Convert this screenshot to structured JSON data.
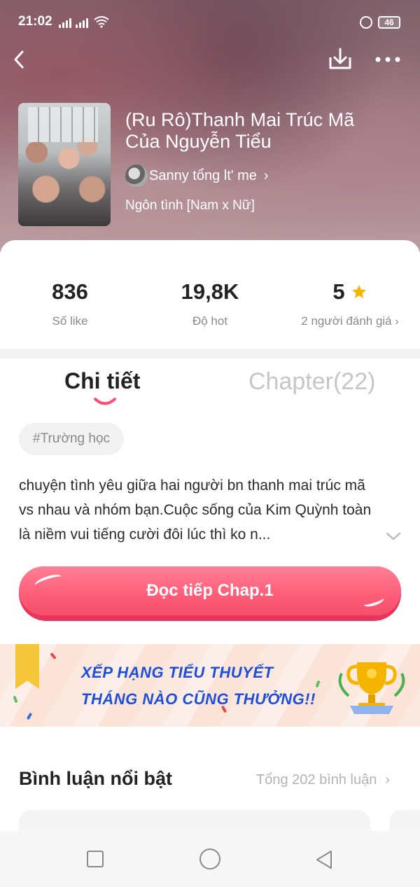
{
  "status_bar": {
    "time": "21:02",
    "battery": "46"
  },
  "book": {
    "title": "(Ru Rô)Thanh Mai Trúc Mã Của Nguyễn Tiểu",
    "author": "Sanny tổng lt' me",
    "genre": "Ngôn tình [Nam x Nữ]"
  },
  "stats": [
    {
      "value": "836",
      "label": "Số like"
    },
    {
      "value": "19,8K",
      "label": "Độ hot"
    },
    {
      "value": "5",
      "label": "2 người đánh giá"
    }
  ],
  "tabs": {
    "details": "Chi tiết",
    "chapters": "Chapter(22)"
  },
  "tag": "#Trường học",
  "description": "chuyện tình yêu giữa hai người bn thanh mai trúc mã vs nhau và nhóm bạn.Cuộc sống của Kim Quỳnh toàn là niềm vui tiếng cười đôi lúc thì ko n...",
  "read_button": "Đọc tiếp Chap.1",
  "banner": {
    "line1": "XẾP HẠNG TIỂU THUYẾT",
    "line2": "THÁNG NÀO CŨNG THƯỞNG!!"
  },
  "comments": {
    "heading": "Bình luận nổi bật",
    "total": "Tổng 202 bình luận"
  },
  "colors": {
    "accent": "#ff5f7a",
    "banner_text": "#1e4fd8",
    "star": "#f5b400"
  },
  "icons": [
    "back-icon",
    "download-icon",
    "more-icon",
    "chevron-right-icon",
    "star-icon",
    "chevron-down-icon",
    "trophy-icon",
    "recent-apps-icon",
    "home-icon",
    "back-nav-icon"
  ]
}
